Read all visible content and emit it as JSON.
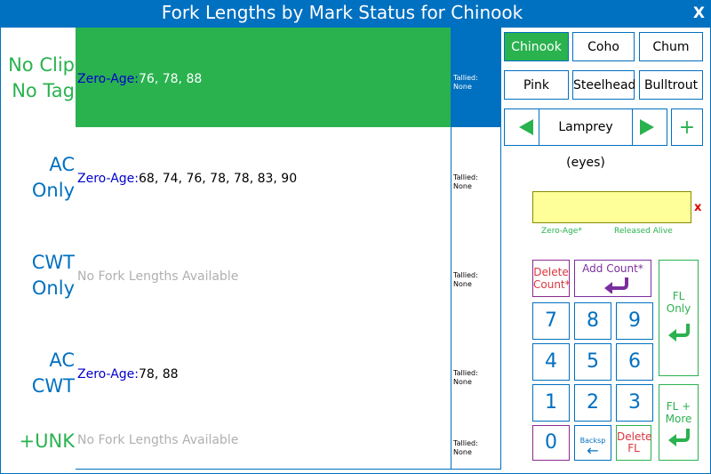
{
  "window": {
    "title": "Fork Lengths by Mark Status for Chinook",
    "close_label": "X"
  },
  "marks": [
    {
      "label_line1": "No Clip",
      "label_line2": "No Tag",
      "color": "#2ab24f",
      "fl_prefix": "Zero-Age:",
      "fl_values": "76, 78, 88",
      "tallied": "Tallied:\nNone",
      "selected": true
    },
    {
      "label_line1": "AC",
      "label_line2": "Only",
      "color": "#0070c0",
      "fl_prefix": "Zero-Age:",
      "fl_values": "68, 74, 76, 78, 78, 83, 90",
      "tallied": "Tallied:\nNone",
      "selected": false
    },
    {
      "label_line1": "CWT",
      "label_line2": "Only",
      "color": "#0070c0",
      "fl_none": "No Fork Lengths Available",
      "tallied": "Tallied:\nNone",
      "selected": false
    },
    {
      "label_line1": "AC",
      "label_line2": "CWT",
      "color": "#0070c0",
      "fl_prefix": "Zero-Age:",
      "fl_values": "78, 88",
      "tallied": "Tallied:\nNone",
      "selected": false
    },
    {
      "label_line1": "+UNK",
      "label_line2": "",
      "color": "#2ab24f",
      "fl_none": "No Fork Lengths Available",
      "tallied": "Tallied:\nNone",
      "selected": false
    }
  ],
  "species": [
    {
      "label": "Chinook",
      "selected": true
    },
    {
      "label": "Coho",
      "selected": false
    },
    {
      "label": "Chum",
      "selected": false
    },
    {
      "label": "Pink",
      "selected": false
    },
    {
      "label": "Steelhead",
      "selected": false
    },
    {
      "label": "Bulltrout",
      "selected": false
    }
  ],
  "lamprey": {
    "label": "Lamprey (eyes)",
    "add": "+"
  },
  "entry": {
    "value": "",
    "clear": "x",
    "age_label": "Zero-Age*",
    "status_label": "Released Alive"
  },
  "keypad": {
    "delete_count_1": "Delete",
    "delete_count_2": "Count*",
    "add_count": "Add Count*",
    "fl_only_1": "FL",
    "fl_only_2": "Only",
    "fl_more_1": "FL +",
    "fl_more_2": "More",
    "keys": [
      "7",
      "8",
      "9",
      "4",
      "5",
      "6",
      "1",
      "2",
      "3"
    ],
    "zero": "0",
    "backspace": "Backsp",
    "delete_fl_1": "Delete",
    "delete_fl_2": "FL"
  },
  "colors": {
    "accent": "#0070c0",
    "green": "#2ab24f",
    "purple": "#7b2f9e",
    "red": "#d9363e",
    "entry_bg": "#ffff99"
  }
}
